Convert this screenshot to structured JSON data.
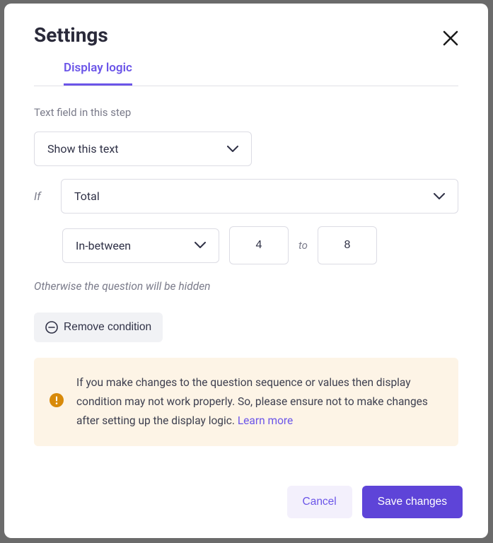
{
  "header": {
    "title": "Settings",
    "tab": "Display logic"
  },
  "section": {
    "label": "Text field in this step",
    "showSelect": "Show this text",
    "ifLabel": "If",
    "fieldSelect": "Total",
    "operatorSelect": "In-between",
    "value1": "4",
    "toLabel": "to",
    "value2": "8",
    "otherwise": "Otherwise the question will be hidden",
    "remove": "Remove condition"
  },
  "warning": {
    "text": "If you make changes to the question sequence or values then display condition may not work properly. So, please ensure not to make changes after setting up the display logic. ",
    "learnMore": "Learn more"
  },
  "footer": {
    "cancel": "Cancel",
    "save": "Save changes"
  }
}
